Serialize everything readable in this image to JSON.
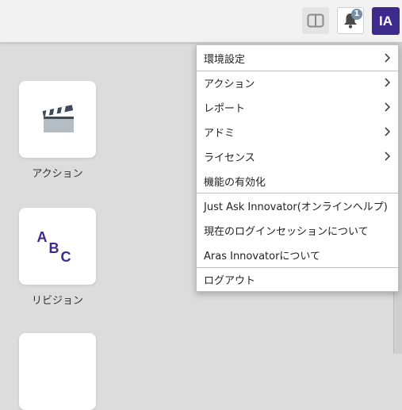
{
  "header": {
    "notification_count": "1",
    "avatar_initials": "IA",
    "accent": "#3d2a8a"
  },
  "tiles": [
    {
      "label": "アクション",
      "icon": "clapperboard-icon"
    },
    {
      "label": "リビジョン",
      "icon": "abc-icon",
      "icon_letters": [
        "A",
        "B",
        "C"
      ]
    },
    {
      "label": "",
      "icon": ""
    }
  ],
  "menu": {
    "items": [
      {
        "label": "環境設定",
        "submenu": true
      },
      {
        "label": "アクション",
        "submenu": true
      },
      {
        "label": "レポート",
        "submenu": true
      },
      {
        "label": "アドミ",
        "submenu": true
      },
      {
        "label": "ライセンス",
        "submenu": true
      },
      {
        "label": "機能の有効化",
        "submenu": false
      },
      {
        "label": "Just Ask Innovator(オンラインヘルプ)",
        "submenu": false
      },
      {
        "label": "現在のログインセッションについて",
        "submenu": false
      },
      {
        "label": "Aras Innovatorについて",
        "submenu": false
      },
      {
        "label": "ログアウト",
        "submenu": false
      }
    ]
  }
}
